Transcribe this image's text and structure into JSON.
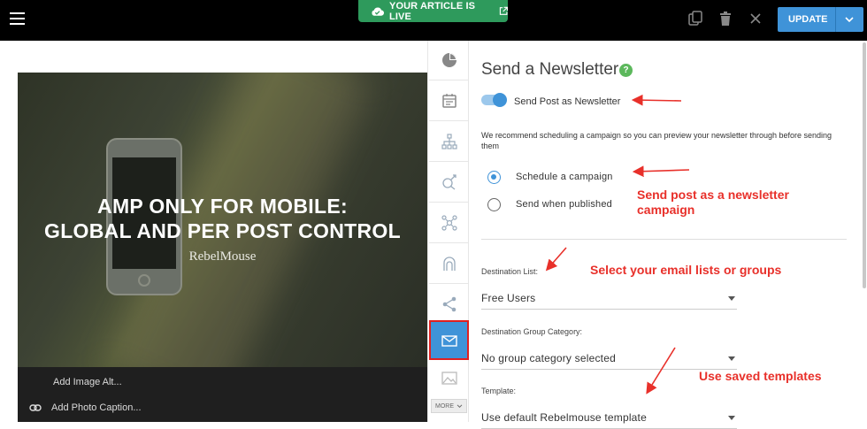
{
  "topbar": {
    "live_label": "YOUR ARTICLE IS LIVE",
    "update_label": "UPDATE"
  },
  "hero": {
    "title_line1": "AMP ONLY FOR MOBILE:",
    "title_line2": "GLOBAL AND PER POST CONTROL",
    "brand": "RebelMouse",
    "add_alt": "Add Image Alt...",
    "add_caption": "Add Photo Caption..."
  },
  "rail": {
    "more_label": "MORE"
  },
  "panel": {
    "title": "Send a Newsletter",
    "help": "?",
    "toggle_label": "Send Post as Newsletter",
    "toggle_on": true,
    "recommend_text": "We recommend scheduling a campaign so you can preview your newsletter through before sending them",
    "radio_schedule": "Schedule a campaign",
    "radio_published": "Send when published",
    "destination_list_label": "Destination List:",
    "destination_list_value": "Free Users",
    "group_category_label": "Destination Group Category:",
    "group_category_value": "No group category selected",
    "template_label": "Template:",
    "template_value": "Use default Rebelmouse template"
  },
  "annotations": {
    "campaign_line1": "Send post as a newsletter",
    "campaign_line2": "campaign",
    "lists": "Select your email lists or groups",
    "templates": "Use saved templates"
  },
  "colors": {
    "accent": "#3f93d8",
    "live_green": "#2e9a5c",
    "annotation_red": "#e8302a"
  }
}
